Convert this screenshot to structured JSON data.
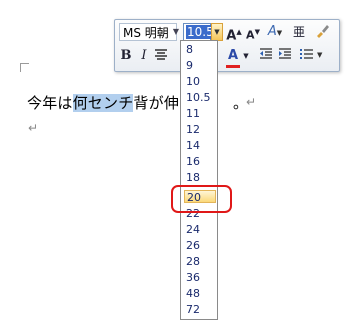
{
  "document": {
    "line1_before": "今年は",
    "line1_selected": "何センチ",
    "line1_after": "背が伸び",
    "line1_end": "。",
    "paragraph_mark": "↵"
  },
  "mini_toolbar": {
    "font_name": "MS 明朝",
    "font_size": "10.5",
    "grow_font": "A",
    "shrink_font": "A",
    "styles": "A",
    "phonetic": "亜",
    "bold": "B",
    "italic": "I",
    "font_color": "A",
    "icons": [
      "paintbrush-icon",
      "center-align-icon",
      "highlight-icon",
      "decrease-indent-icon",
      "increase-indent-icon",
      "bullets-icon"
    ],
    "font_color_hex": "#e02020"
  },
  "font_size_list": {
    "items": [
      "8",
      "9",
      "10",
      "10.5",
      "11",
      "12",
      "14",
      "16",
      "18",
      "20",
      "22",
      "24",
      "26",
      "28",
      "36",
      "48",
      "72"
    ],
    "highlighted": "20"
  }
}
